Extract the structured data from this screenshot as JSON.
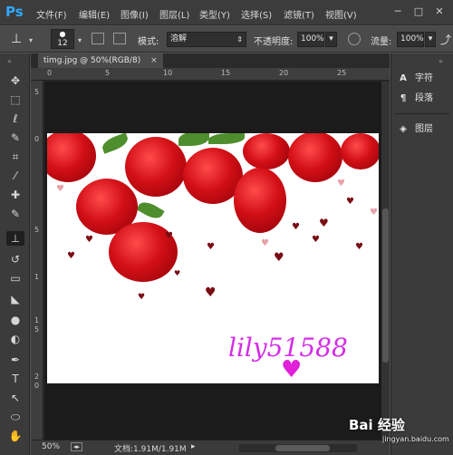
{
  "app": {
    "logo": "Ps"
  },
  "menu": [
    "文件(F)",
    "编辑(E)",
    "图像(I)",
    "图层(L)",
    "类型(Y)",
    "选择(S)",
    "滤镜(T)",
    "视图(V)"
  ],
  "window_controls": {
    "minimize": "─",
    "restore": "□",
    "close": "✕"
  },
  "options": {
    "brush_size": "12",
    "mode_label": "模式:",
    "mode_value": "溶解",
    "opacity_label": "不透明度:",
    "opacity_value": "100%",
    "flow_label": "流量:",
    "flow_value": "100%"
  },
  "document": {
    "tab_title": "timg.jpg @ 50%(RGB/8)",
    "tab_close": "×",
    "zoom": "50%",
    "doc_info": "文档:1.91M/1.91M",
    "ruler_top": [
      "0",
      "5",
      "10",
      "15",
      "20",
      "25"
    ],
    "ruler_left": [
      "5",
      "0",
      "5",
      "1",
      "1",
      "5",
      "2",
      "0"
    ],
    "watermark_text": "lily51588",
    "watermark_heart": "♥"
  },
  "tools": [
    {
      "icon": "move-icon",
      "glyph": "✥"
    },
    {
      "icon": "marquee-icon",
      "glyph": "⬚"
    },
    {
      "icon": "lasso-icon",
      "glyph": "ℓ"
    },
    {
      "icon": "quick-select-icon",
      "glyph": "✎"
    },
    {
      "icon": "crop-icon",
      "glyph": "⌗"
    },
    {
      "icon": "eyedropper-icon",
      "glyph": "⁄"
    },
    {
      "icon": "healing-icon",
      "glyph": "✚"
    },
    {
      "icon": "brush-icon",
      "glyph": "✎"
    },
    {
      "icon": "clone-stamp-icon",
      "glyph": "⊥"
    },
    {
      "icon": "history-brush-icon",
      "glyph": "↺"
    },
    {
      "icon": "eraser-icon",
      "glyph": "▭"
    },
    {
      "icon": "bucket-icon",
      "glyph": "◣"
    },
    {
      "icon": "blur-icon",
      "glyph": "●"
    },
    {
      "icon": "dodge-icon",
      "glyph": "◐"
    },
    {
      "icon": "pen-icon",
      "glyph": "✒"
    },
    {
      "icon": "type-icon",
      "glyph": "T"
    },
    {
      "icon": "path-select-icon",
      "glyph": "↖"
    },
    {
      "icon": "ellipse-icon",
      "glyph": "⬭"
    },
    {
      "icon": "hand-icon",
      "glyph": "✋"
    }
  ],
  "panels": [
    {
      "icon": "character-icon",
      "glyph": "A",
      "label": "字符"
    },
    {
      "icon": "paragraph-icon",
      "glyph": "¶",
      "label": "段落"
    },
    {
      "icon": "layers-icon",
      "glyph": "◈",
      "label": "图层"
    }
  ],
  "baidu": {
    "logo": "Bai 经验",
    "sub": "jingyan.baidu.com"
  }
}
